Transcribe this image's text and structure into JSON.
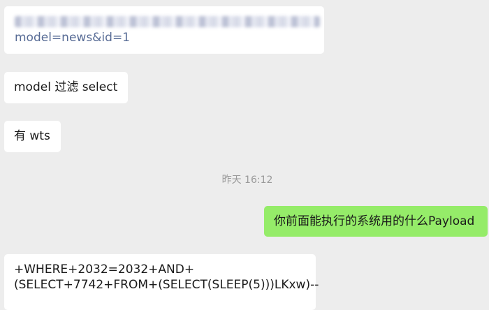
{
  "messages": [
    {
      "side": "incoming",
      "obscured_text": true,
      "link_text": "model=news&id=1"
    },
    {
      "side": "incoming",
      "text": "model 过滤 select"
    },
    {
      "side": "incoming",
      "text": "有 wts"
    },
    {
      "side": "outgoing",
      "text": "你前面能执行的系统用的什么Payload"
    },
    {
      "side": "incoming",
      "lines": [
        "+WHERE+2032=2032+AND+",
        "(SELECT+7742+FROM+(SELECT(SLEEP(5)))LKxw)--"
      ]
    }
  ],
  "timestamp": "昨天 16:12",
  "colors": {
    "background": "#ededed",
    "incoming_bubble": "#ffffff",
    "outgoing_bubble": "#95ec69",
    "link": "#576b95",
    "timestamp_text": "#9a9a9a"
  }
}
